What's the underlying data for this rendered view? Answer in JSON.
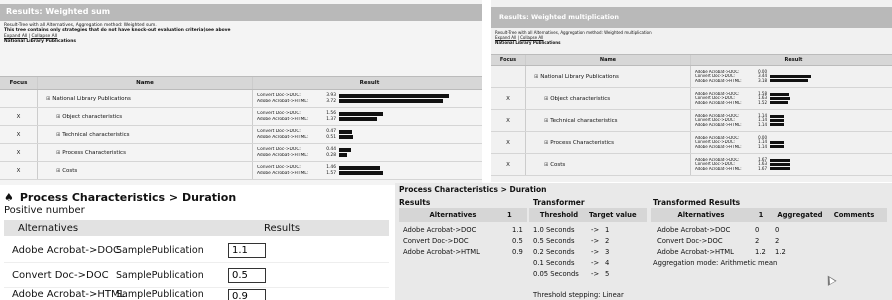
{
  "colors": {
    "bar": "#111111",
    "title_bar": "#b9b9b9",
    "header": "#d7d7d7"
  },
  "icons": [
    "expand-plus-icon",
    "spade-icon",
    "mouse-cursor-icon"
  ],
  "sum_panel": {
    "title": "Results: Weighted sum",
    "meta_line1": "Result-Tree with all Alternatives, Aggregation method: Weighted sum.",
    "meta_line2": "This tree contains only strategies that do not have knock-out evaluation criteria(see above",
    "expand_all": "Expand All",
    "separator": " | ",
    "collapse_all": "Collapse All",
    "root_name": "National Library Publications",
    "col_focus": "Focus",
    "col_name": "Name",
    "col_result": "Result",
    "rows": [
      {
        "focus": "",
        "name": "National Library Publications",
        "results": [
          {
            "alt": "Convert Doc->DOC:",
            "value": "3.93",
            "fraction": 0.786
          },
          {
            "alt": "Adobe Acrobat->HTML:",
            "value": "3.72",
            "fraction": 0.744
          }
        ]
      },
      {
        "focus": "X",
        "name": "Object characteristics",
        "results": [
          {
            "alt": "Convert Doc->DOC:",
            "value": "1.56",
            "fraction": 0.312
          },
          {
            "alt": "Adobe Acrobat->HTML:",
            "value": "1.37",
            "fraction": 0.274
          }
        ]
      },
      {
        "focus": "X",
        "name": "Technical characteristics",
        "results": [
          {
            "alt": "Convert Doc->DOC:",
            "value": "0.47",
            "fraction": 0.094
          },
          {
            "alt": "Adobe Acrobat->HTML:",
            "value": "0.51",
            "fraction": 0.102
          }
        ]
      },
      {
        "focus": "X",
        "name": "Process Characteristics",
        "results": [
          {
            "alt": "Convert Doc->DOC:",
            "value": "0.44",
            "fraction": 0.088
          },
          {
            "alt": "Adobe Acrobat->HTML:",
            "value": "0.28",
            "fraction": 0.056
          }
        ]
      },
      {
        "focus": "X",
        "name": "Costs",
        "results": [
          {
            "alt": "Convert Doc->DOC:",
            "value": "1.46",
            "fraction": 0.292
          },
          {
            "alt": "Adobe Acrobat->HTML:",
            "value": "1.57",
            "fraction": 0.314
          }
        ]
      }
    ]
  },
  "mult_panel": {
    "title": "Results: Weighted multiplication",
    "meta_line1": "Result-Tree with all Alternatives, Aggregation method: Weighted multiplication",
    "expand_all": "Expand All",
    "separator": " | ",
    "collapse_all": "Collapse All",
    "root_name": "National Library Publications",
    "col_focus": "Focus",
    "col_name": "Name",
    "col_result": "Result",
    "rows": [
      {
        "focus": "",
        "name": "National Library Publications",
        "results": [
          {
            "alt": "Adobe Acrobat->DOC:",
            "value": "0.00",
            "fraction": 0.0
          },
          {
            "alt": "Convert Doc->DOC:",
            "value": "3.44",
            "fraction": 0.688
          },
          {
            "alt": "Adobe Acrobat->HTML:",
            "value": "3.18",
            "fraction": 0.636
          }
        ]
      },
      {
        "focus": "X",
        "name": "Object characteristics",
        "results": [
          {
            "alt": "Adobe Acrobat->DOC:",
            "value": "1.58",
            "fraction": 0.316
          },
          {
            "alt": "Convert Doc->DOC:",
            "value": "1.63",
            "fraction": 0.326
          },
          {
            "alt": "Adobe Acrobat->HTML:",
            "value": "1.52",
            "fraction": 0.304
          }
        ]
      },
      {
        "focus": "X",
        "name": "Technical characteristics",
        "results": [
          {
            "alt": "Adobe Acrobat->DOC:",
            "value": "1.14",
            "fraction": 0.228
          },
          {
            "alt": "Convert Doc->DOC:",
            "value": "1.14",
            "fraction": 0.228
          },
          {
            "alt": "Adobe Acrobat->HTML:",
            "value": "1.14",
            "fraction": 0.228
          }
        ]
      },
      {
        "focus": "X",
        "name": "Process Characteristics",
        "results": [
          {
            "alt": "Adobe Acrobat->DOC:",
            "value": "0.00",
            "fraction": 0.0
          },
          {
            "alt": "Convert Doc->DOC:",
            "value": "1.14",
            "fraction": 0.228
          },
          {
            "alt": "Adobe Acrobat->HTML:",
            "value": "1.14",
            "fraction": 0.228
          }
        ]
      },
      {
        "focus": "X",
        "name": "Costs",
        "results": [
          {
            "alt": "Adobe Acrobat->DOC:",
            "value": "1.67",
            "fraction": 0.334
          },
          {
            "alt": "Convert Doc->DOC:",
            "value": "1.63",
            "fraction": 0.326
          },
          {
            "alt": "Adobe Acrobat->HTML:",
            "value": "1.67",
            "fraction": 0.334
          }
        ]
      }
    ]
  },
  "duration_panel": {
    "title": "Process Characteristics > Duration",
    "subtitle": "Positive number",
    "col_alternatives": "Alternatives",
    "col_results": "Results",
    "rows": [
      {
        "alt": "Adobe Acrobat->DOC",
        "pub": "SamplePublication",
        "value": "1.1"
      },
      {
        "alt": "Convert Doc->DOC",
        "pub": "SamplePublication",
        "value": "0.5"
      },
      {
        "alt": "Adobe Acrobat->HTML",
        "pub": "SamplePublication",
        "value": "0.9"
      }
    ]
  },
  "transformer_panel": {
    "title": "Process Characteristics > Duration",
    "results_heading": "Results",
    "transformer_heading": "Transformer",
    "transformed_heading": "Transformed Results",
    "col_alternatives": "Alternatives",
    "col_one": "1",
    "col_threshold": "Threshold",
    "col_target": "Target value",
    "col_alternatives2": "Alternatives",
    "col_one2": "1",
    "col_aggregated": "Aggregated",
    "col_comments": "Comments",
    "results_rows": [
      {
        "alt": "Adobe Acrobat->DOC",
        "value": "1.1"
      },
      {
        "alt": "Convert Doc->DOC",
        "value": "0.5"
      },
      {
        "alt": "Adobe Acrobat->HTML",
        "value": "0.9"
      }
    ],
    "threshold_rows": [
      {
        "threshold": "1.0 Seconds",
        "arrow": "->",
        "target": "1"
      },
      {
        "threshold": "0.5 Seconds",
        "arrow": "->",
        "target": "2"
      },
      {
        "threshold": "0.2 Seconds",
        "arrow": "->",
        "target": "3"
      },
      {
        "threshold": "0.1 Seconds",
        "arrow": "->",
        "target": "4"
      },
      {
        "threshold": "0.05 Seconds",
        "arrow": "->",
        "target": "5"
      }
    ],
    "threshold_stepping": "Threshold stepping: Linear",
    "transformed_rows": [
      {
        "alt": "Adobe Acrobat->DOC",
        "one": "0",
        "agg": "0"
      },
      {
        "alt": "Convert Doc->DOC",
        "one": "2",
        "agg": "2"
      },
      {
        "alt": "Adobe Acrobat->HTML",
        "one": "1.2",
        "agg": "1.2"
      }
    ],
    "aggregation_mode": "Aggregation mode: Arithmetic mean"
  }
}
